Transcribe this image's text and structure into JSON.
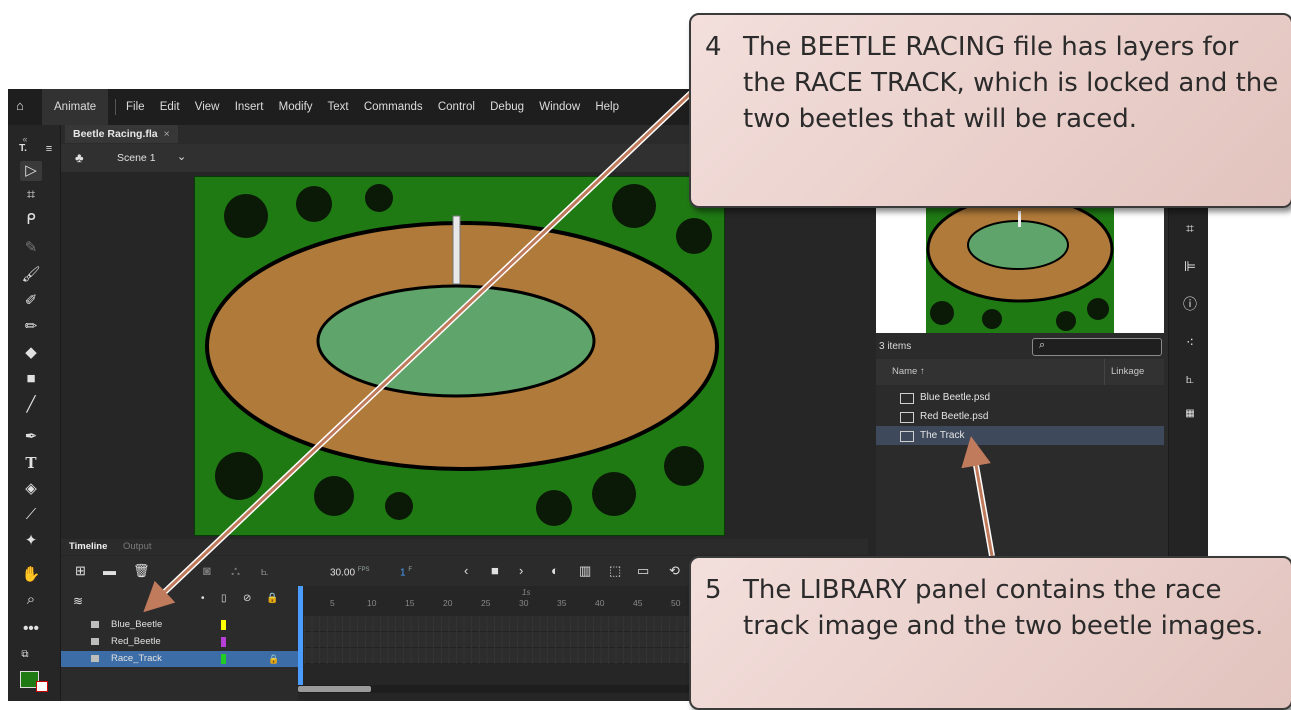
{
  "app": {
    "workspace_label": "Animate",
    "menu": [
      "File",
      "Edit",
      "View",
      "Insert",
      "Modify",
      "Text",
      "Commands",
      "Control",
      "Debug",
      "Window",
      "Help"
    ]
  },
  "document": {
    "tab_label": "Beetle Racing.fla",
    "close_glyph": "×",
    "scene_label": "Scene 1"
  },
  "timeline": {
    "tab_timeline": "Timeline",
    "tab_output": "Output",
    "fps_value": "30.00",
    "fps_unit": "FPS",
    "frame_value": "1",
    "frame_unit": "F",
    "second_marker": "1s",
    "ruler_numbers": [
      "5",
      "10",
      "15",
      "20",
      "25",
      "30",
      "35",
      "40",
      "45",
      "50"
    ],
    "layers": [
      {
        "name": "Blue_Beetle",
        "color": "#ffff00",
        "locked": false
      },
      {
        "name": "Red_Beetle",
        "color": "#b63fd6",
        "locked": false
      },
      {
        "name": "Race_Track",
        "color": "#22cc22",
        "locked": true
      }
    ]
  },
  "library": {
    "item_count": "3 items",
    "search_placeholder": "",
    "col_name": "Name",
    "col_linkage": "Linkage",
    "items": [
      {
        "label": "Blue Beetle.psd",
        "selected": false
      },
      {
        "label": "Red Beetle.psd",
        "selected": false
      },
      {
        "label": "The Track",
        "selected": true
      }
    ]
  },
  "callouts": {
    "c4_number": "4",
    "c4_text": "The BEETLE RACING file has layers for the RACE TRACK, which is locked and the two beetles that will be raced.",
    "c5_number": "5",
    "c5_text": "The LIBRARY panel contains the race track image and the two beetle images."
  },
  "colors": {
    "accent_blue": "#4a9cff",
    "selected_layer": "#3c6da6",
    "callout_fill": "#ecd2cd",
    "arrow": "#c07a5c",
    "track_brown": "#b07a3a",
    "infield_green": "#5fa46a",
    "grass_green": "#1f7a14"
  }
}
